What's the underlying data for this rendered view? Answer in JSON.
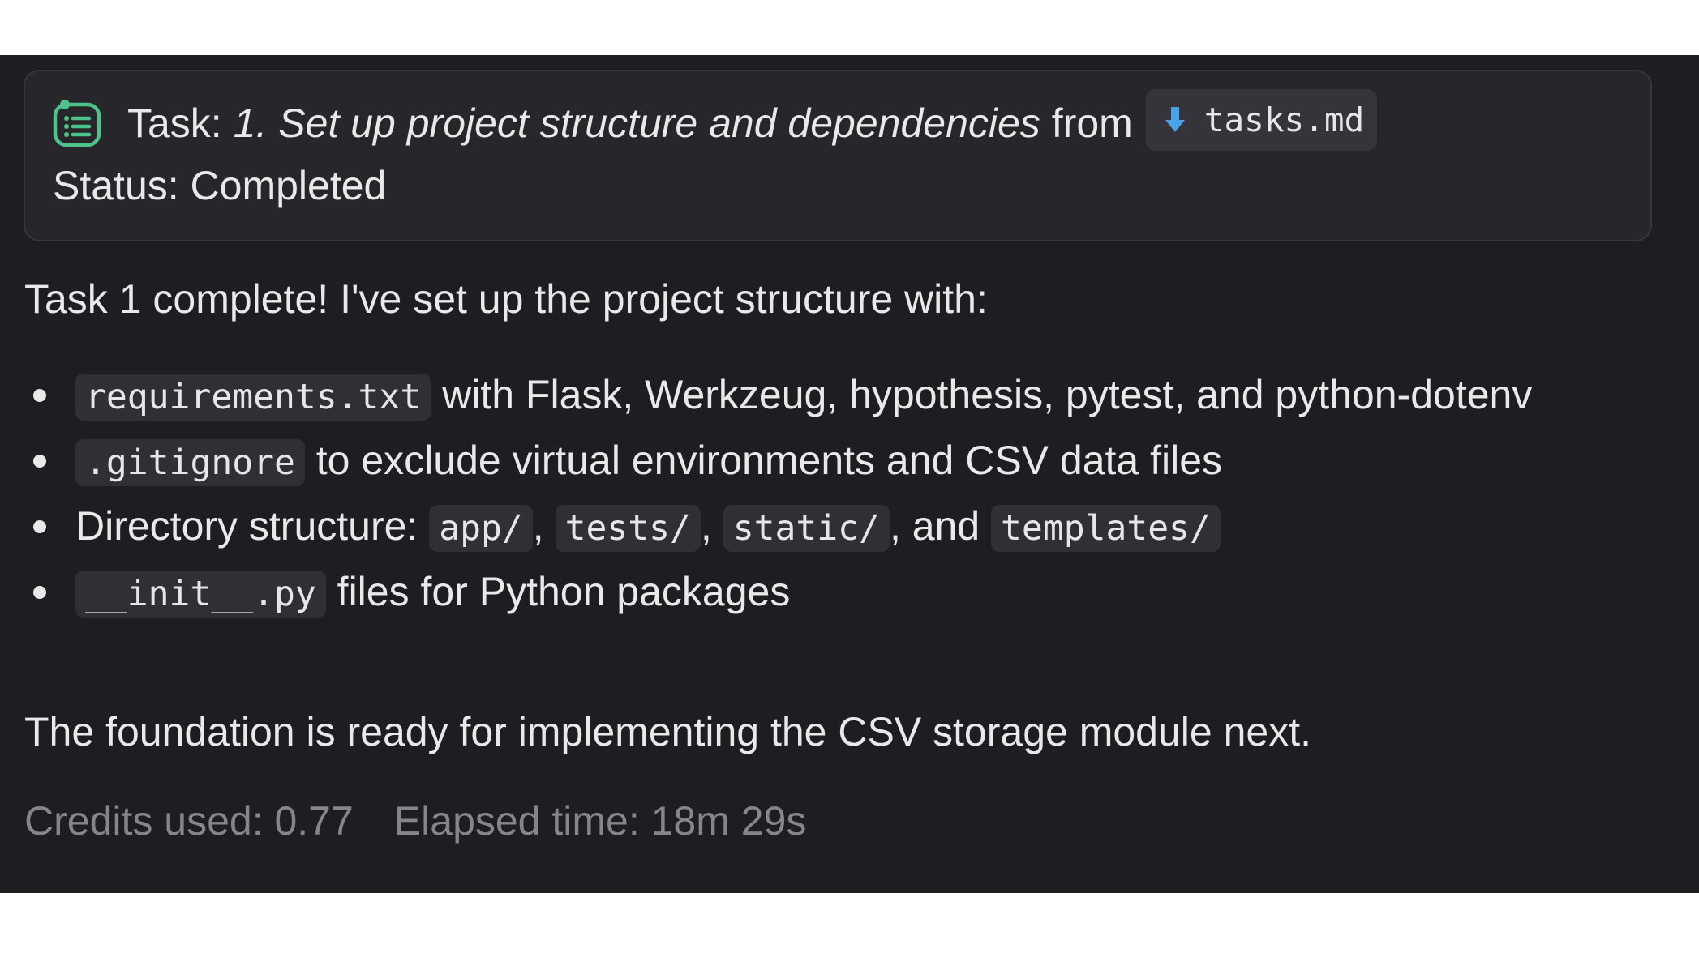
{
  "task_card": {
    "prefix": "Task:",
    "name": "1. Set up project structure and dependencies",
    "from_label": "from",
    "file_name": "tasks.md",
    "status": "Status: Completed",
    "icon": "task-list-icon",
    "file_icon": "arrow-down-icon",
    "accent_color": "#4cc38a",
    "file_icon_color": "#4aa3e8"
  },
  "message": {
    "intro": "Task 1 complete! I've set up the project structure with:",
    "bullets": [
      {
        "code": "requirements.txt",
        "text": " with Flask, Werkzeug, hypothesis, pytest, and python-dotenv"
      },
      {
        "code": ".gitignore",
        "text": " to exclude virtual environments and CSV data files"
      },
      {
        "text_prefix": "Directory structure: ",
        "codes": [
          "app/",
          "tests/",
          "static/",
          "templates/"
        ],
        "sep1": ", ",
        "sep2": ", ",
        "sep3": ", and "
      },
      {
        "code": "__init__.py",
        "text": " files for Python packages"
      }
    ],
    "outro": "The foundation is ready for implementing the CSV storage module next."
  },
  "footer": {
    "credits": "Credits used: 0.77",
    "elapsed": "Elapsed time: 18m 29s"
  }
}
